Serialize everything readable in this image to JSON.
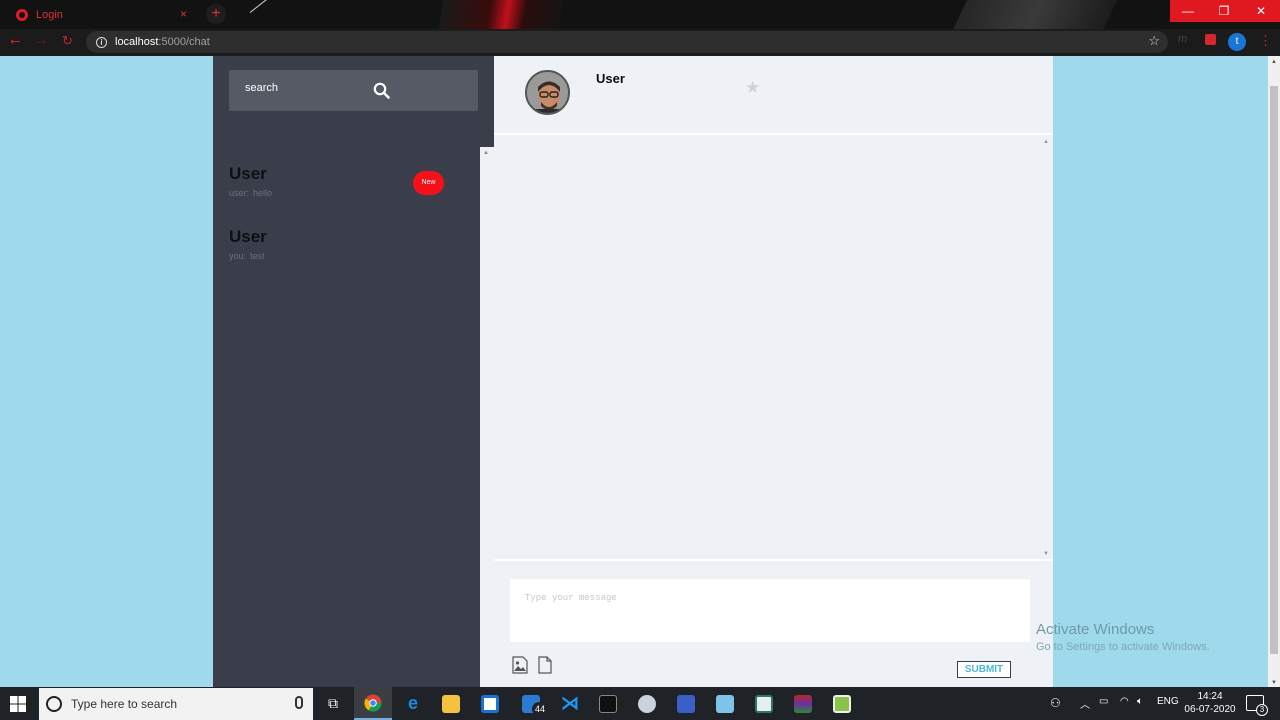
{
  "browser": {
    "tab_title": "Login",
    "tab_close": "×",
    "new_tab": "+",
    "url_host": "localhost",
    "url_path": ":5000/chat",
    "profile_initial": "t",
    "window_controls": {
      "minimize": "—",
      "restore": "❐",
      "close": "✕"
    }
  },
  "sidebar": {
    "search_placeholder": "search",
    "conversations": [
      {
        "name": "User",
        "sender": "user:",
        "message": "hello",
        "badge": "New"
      },
      {
        "name": "User",
        "sender": "you:",
        "message": "test"
      }
    ]
  },
  "chat": {
    "header_name": "User",
    "composer_placeholder": "Type your message",
    "submit_label": "SUBMIT"
  },
  "watermark": {
    "title": "Activate Windows",
    "subtitle": "Go to Settings to activate Windows."
  },
  "taskbar": {
    "search_text": "Type here to search",
    "mail_badge": "44",
    "language": "ENG",
    "time": "14:24",
    "date": "06-07-2020",
    "notification_count": "3"
  },
  "colors": {
    "page_bg": "#9ed9ec",
    "sidebar_bg": "#3a3e4a",
    "chat_bg": "#eef2f6",
    "badge_red": "#f5101a",
    "submit_text": "#4db8dd"
  }
}
